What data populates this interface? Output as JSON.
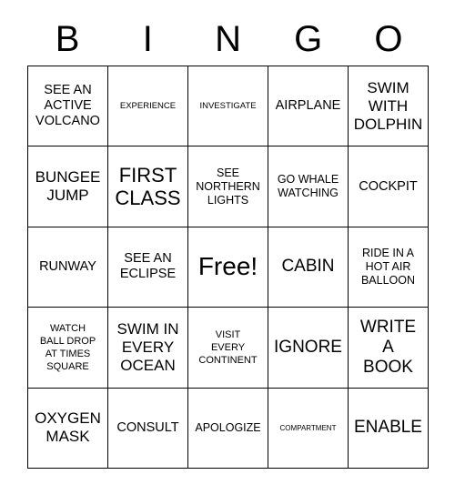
{
  "card": {
    "title_letters": [
      "B",
      "I",
      "N",
      "G",
      "O"
    ],
    "free_space_label": "Free!",
    "border_color": "#000000",
    "text_color": "#000000",
    "background_color": "#ffffff"
  },
  "grid": {
    "columns": 5,
    "rows": 5,
    "cells": [
      {
        "text": "SEE AN\nACTIVE\nVOLCANO",
        "size": "ml"
      },
      {
        "text": "EXPERIENCE",
        "size": "s"
      },
      {
        "text": "INVESTIGATE",
        "size": "s"
      },
      {
        "text": "AIRPLANE",
        "size": "ml"
      },
      {
        "text": "SWIM\nWITH\nDOLPHIN",
        "size": "l"
      },
      {
        "text": "BUNGEE\nJUMP",
        "size": "l"
      },
      {
        "text": "FIRST\nCLASS",
        "size": "2xl"
      },
      {
        "text": "SEE\nNORTHERN\nLIGHTS",
        "size": "m"
      },
      {
        "text": "GO WHALE\nWATCHING",
        "size": "m"
      },
      {
        "text": "COCKPIT",
        "size": "ml"
      },
      {
        "text": "RUNWAY",
        "size": "ml"
      },
      {
        "text": "SEE AN\nECLIPSE",
        "size": "ml"
      },
      {
        "text": "Free!",
        "size": "3xl"
      },
      {
        "text": "CABIN",
        "size": "xl"
      },
      {
        "text": "RIDE IN A\nHOT AIR\nBALLOON",
        "size": "m"
      },
      {
        "text": "WATCH\nBALL DROP\nAT TIMES\nSQUARE",
        "size": "sm"
      },
      {
        "text": "SWIM IN\nEVERY\nOCEAN",
        "size": "l"
      },
      {
        "text": "VISIT\nEVERY\nCONTINENT",
        "size": "sm"
      },
      {
        "text": "IGNORE",
        "size": "xl"
      },
      {
        "text": "WRITE\nA\nBOOK",
        "size": "xl"
      },
      {
        "text": "OXYGEN\nMASK",
        "size": "l"
      },
      {
        "text": "CONSULT",
        "size": "ml"
      },
      {
        "text": "APOLOGIZE",
        "size": "m"
      },
      {
        "text": "COMPARTMENT",
        "size": "xs"
      },
      {
        "text": "ENABLE",
        "size": "xl"
      }
    ]
  }
}
